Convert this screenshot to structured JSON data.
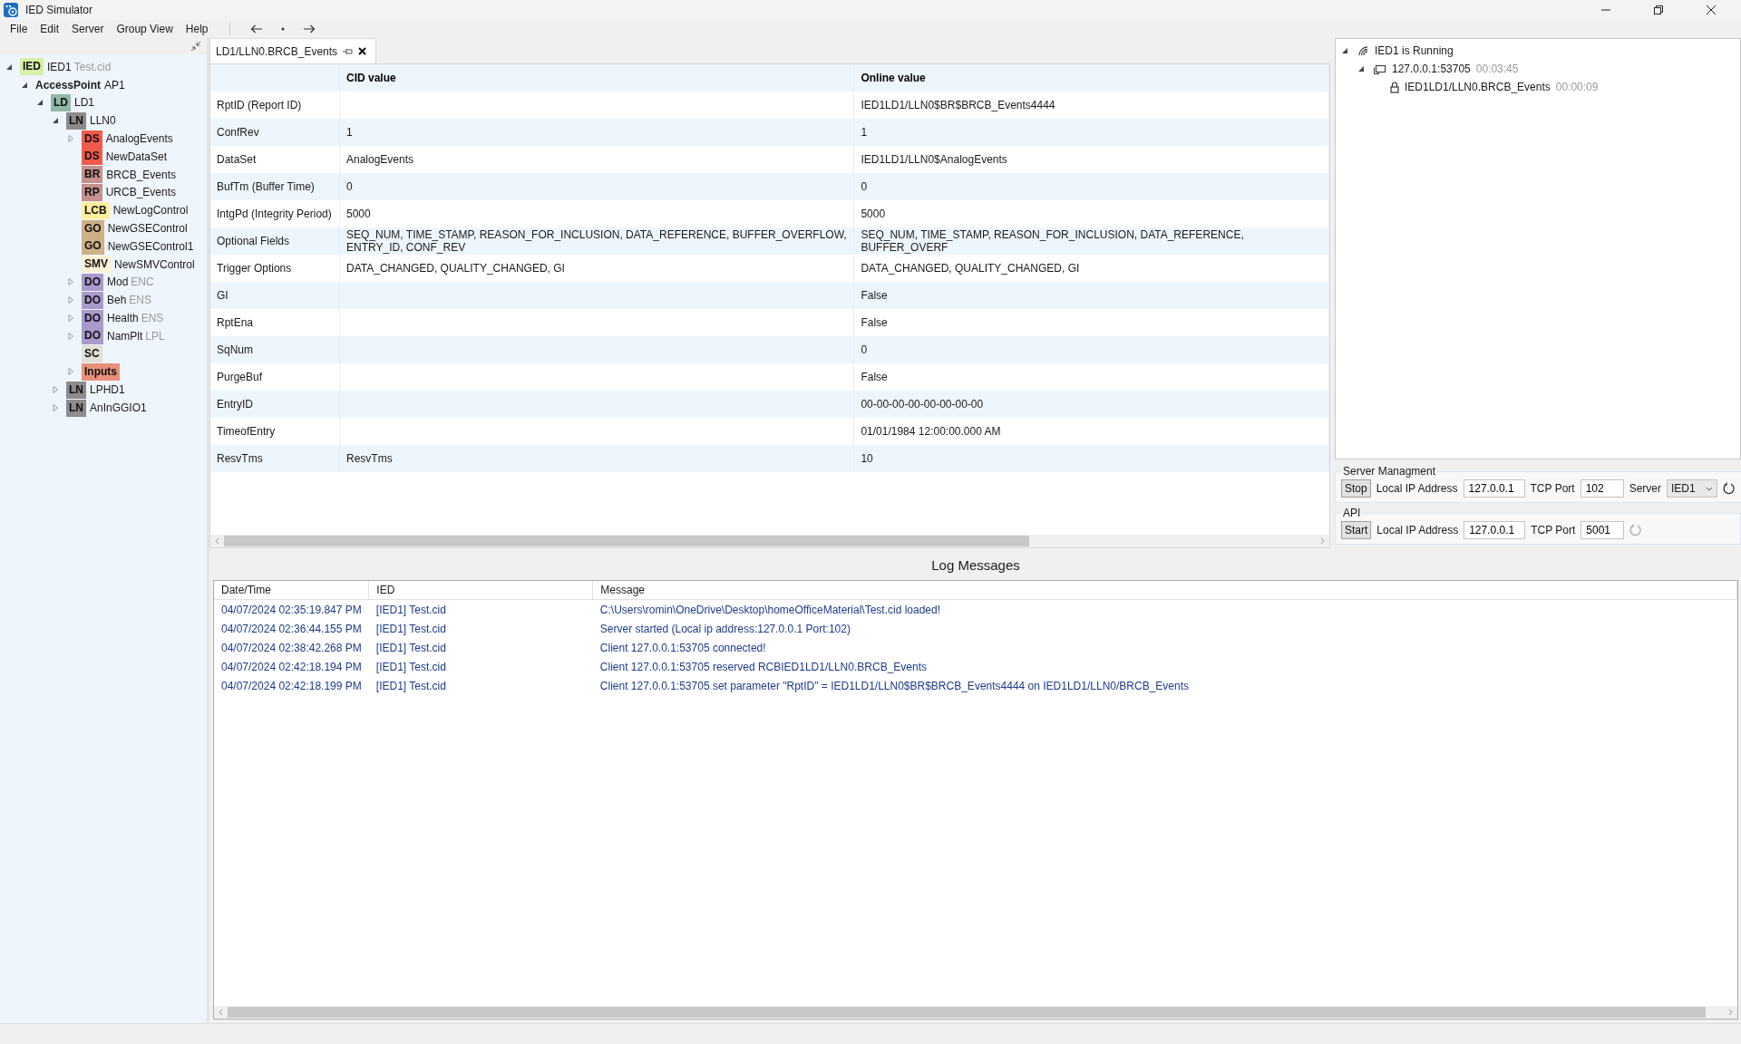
{
  "window": {
    "title": "IED Simulator"
  },
  "menu": [
    "File",
    "Edit",
    "Server",
    "Group View",
    "Help"
  ],
  "tree": [
    {
      "tag": "IED",
      "color": "#d6f0a6",
      "name": "IED1",
      "note": "Test.cid",
      "expanded": true,
      "children": [
        {
          "tag": "AccessPoint",
          "name": "AP1",
          "expanded": true,
          "children": [
            {
              "tag": "LD",
              "color": "#8fb9a6",
              "name": "LD1",
              "expanded": true,
              "children": [
                {
                  "tag": "LN",
                  "color": "#8c8c8c",
                  "name": "LLN0",
                  "expanded": true,
                  "children": [
                    {
                      "tag": "DS",
                      "color": "#f05a4a",
                      "name": "AnalogEvents",
                      "expanded": false
                    },
                    {
                      "tag": "DS",
                      "color": "#f05a4a",
                      "name": "NewDataSet"
                    },
                    {
                      "tag": "BR",
                      "color": "#c4908c",
                      "name": "BRCB_Events"
                    },
                    {
                      "tag": "RP",
                      "color": "#c4908c",
                      "name": "URCB_Events"
                    },
                    {
                      "tag": "LCB",
                      "color": "#fff0a0",
                      "name": "NewLogControl"
                    },
                    {
                      "tag": "GO",
                      "color": "#ccb088",
                      "name": "NewGSEControl"
                    },
                    {
                      "tag": "GO",
                      "color": "#ccb088",
                      "name": "NewGSEControl1"
                    },
                    {
                      "tag": "SMV",
                      "color": "#fff2d6",
                      "name": "NewSMVControl"
                    },
                    {
                      "tag": "DO",
                      "color": "#a999cc",
                      "name": "Mod",
                      "note": "ENC",
                      "expanded": false
                    },
                    {
                      "tag": "DO",
                      "color": "#a999cc",
                      "name": "Beh",
                      "note": "ENS",
                      "expanded": false
                    },
                    {
                      "tag": "DO",
                      "color": "#a999cc",
                      "name": "Health",
                      "note": "ENS",
                      "expanded": false
                    },
                    {
                      "tag": "DO",
                      "color": "#a999cc",
                      "name": "NamPlt",
                      "note": "LPL",
                      "expanded": false
                    },
                    {
                      "tag": "SC",
                      "color": "#e2e0d6"
                    },
                    {
                      "tag": "Inputs",
                      "color": "#e8907a",
                      "expanded": false
                    }
                  ]
                },
                {
                  "tag": "LN",
                  "color": "#8c8c8c",
                  "name": "LPHD1",
                  "expanded": false
                },
                {
                  "tag": "LN",
                  "color": "#8c8c8c",
                  "name": "AnInGGIO1",
                  "expanded": false
                }
              ]
            }
          ]
        }
      ]
    }
  ],
  "document_tab": {
    "title": "LD1/LLN0.BRCB_Events",
    "selected": true
  },
  "table": {
    "columns": [
      "",
      "CID value",
      "Online value"
    ],
    "rows": [
      [
        "RptID (Report ID)",
        "",
        "IED1LD1/LLN0$BR$BRCB_Events4444"
      ],
      [
        "ConfRev",
        "1",
        "1"
      ],
      [
        "DataSet",
        "AnalogEvents",
        "IED1LD1/LLN0$AnalogEvents"
      ],
      [
        "BufTm (Buffer Time)",
        "0",
        "0"
      ],
      [
        "IntgPd (Integrity Period)",
        "5000",
        "5000"
      ],
      [
        "Optional Fields",
        "SEQ_NUM, TIME_STAMP, REASON_FOR_INCLUSION, DATA_REFERENCE, BUFFER_OVERFLOW, ENTRY_ID, CONF_REV",
        "SEQ_NUM, TIME_STAMP, REASON_FOR_INCLUSION, DATA_REFERENCE, BUFFER_OVERF"
      ],
      [
        "Trigger Options",
        "DATA_CHANGED, QUALITY_CHANGED, GI",
        "DATA_CHANGED, QUALITY_CHANGED, GI"
      ],
      [
        "GI",
        "",
        "False"
      ],
      [
        "RptEna",
        "",
        "False"
      ],
      [
        "SqNum",
        "",
        "0"
      ],
      [
        "PurgeBuf",
        "",
        "False"
      ],
      [
        "EntryID",
        "",
        "00-00-00-00-00-00-00-00"
      ],
      [
        "TimeofEntry",
        "",
        "01/01/1984 12:00:00.000 AM"
      ],
      [
        "ResvTms",
        "ResvTms",
        "10"
      ]
    ]
  },
  "connections": [
    {
      "kind": "server",
      "label": "IED1 is Running",
      "expanded": true,
      "children": [
        {
          "kind": "client",
          "label": "127.0.0.1:53705",
          "time": "00:03:45",
          "expanded": true,
          "children": [
            {
              "kind": "lock",
              "label": "IED1LD1/LLN0.BRCB_Events",
              "time": "00:00:09"
            }
          ]
        }
      ]
    }
  ],
  "server_management": {
    "title": "Server Managment",
    "button": "Stop",
    "ip_label": "Local IP Address",
    "ip": "127.0.0.1",
    "port_label": "TCP Port",
    "port": "102",
    "server_label": "Server",
    "server": "IED1",
    "refresh_enabled": true
  },
  "api": {
    "title": "API",
    "button": "Start",
    "ip_label": "Local IP Address",
    "ip": "127.0.0.1",
    "port_label": "TCP Port",
    "port": "5001",
    "refresh_enabled": false
  },
  "log": {
    "title": "Log Messages",
    "columns": [
      "Date/Time",
      "IED",
      "Message"
    ],
    "rows": [
      [
        "04/07/2024 02:35:19.847 PM",
        "[IED1] Test.cid",
        "C:\\Users\\romin\\OneDrive\\Desktop\\homeOfficeMaterial\\Test.cid loaded!"
      ],
      [
        "04/07/2024 02:36:44.155 PM",
        "[IED1] Test.cid",
        "Server started (Local ip address:127.0.0.1 Port:102)"
      ],
      [
        "04/07/2024 02:38:42.268 PM",
        "[IED1] Test.cid",
        "Client 127.0.0.1:53705 connected!"
      ],
      [
        "04/07/2024 02:42:18.194 PM",
        "[IED1] Test.cid",
        "Client 127.0.0.1:53705 reserved RCBIED1LD1/LLN0.BRCB_Events"
      ],
      [
        "04/07/2024 02:42:18.199 PM",
        "[IED1] Test.cid",
        "Client 127.0.0.1:53705 set parameter \"RptID\" = IED1LD1/LLN0$BR$BRCB_Events4444 on IED1LD1/LLN0/BRCB_Events"
      ]
    ]
  }
}
